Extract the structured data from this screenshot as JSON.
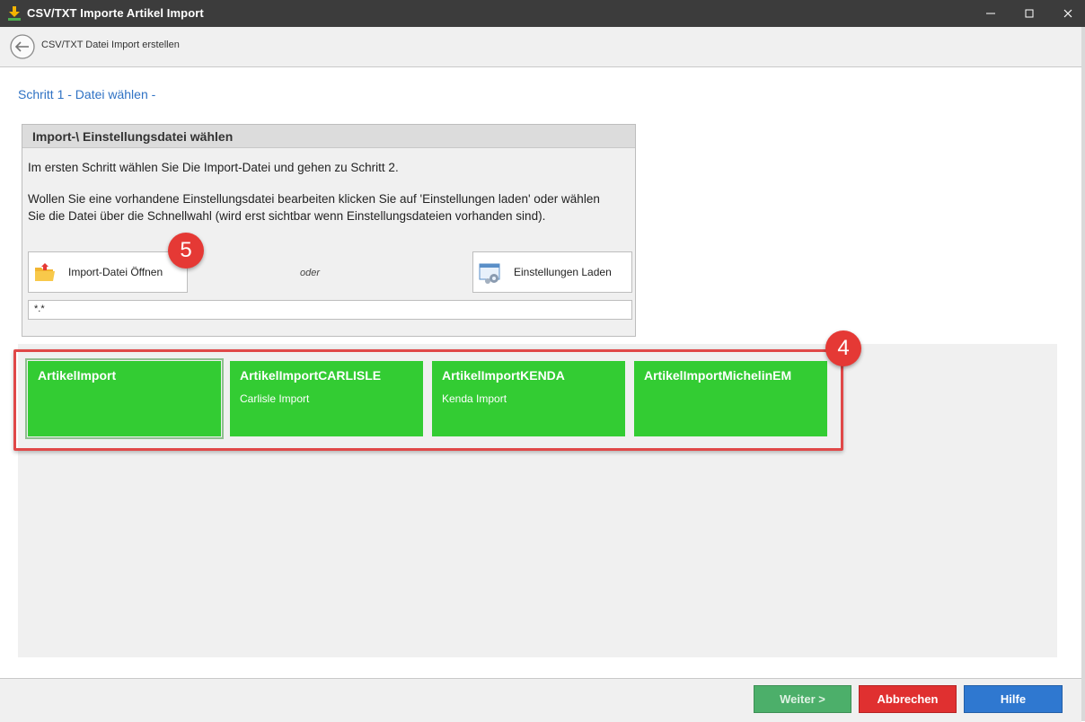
{
  "window": {
    "title": "CSV/TXT Importe Artikel Import"
  },
  "nav": {
    "title": "CSV/TXT Datei Import erstellen"
  },
  "step": {
    "title": "Schritt 1 - Datei wählen -"
  },
  "panel": {
    "title": "Import-\\ Einstellungsdatei wählen",
    "line1": "Im ersten Schritt wählen Sie Die Import-Datei und gehen zu Schritt 2.",
    "line2": "Wollen Sie eine vorhandene Einstellungsdatei bearbeiten klicken Sie auf 'Einstellungen laden' oder wählen",
    "line3": "Sie die Datei über die Schnellwahl (wird erst sichtbar wenn Einstellungsdateien vorhanden sind).",
    "open_button": "Import-Datei Öffnen",
    "or_text": "oder",
    "load_button": "Einstellungen Laden",
    "filter_value": "*.*"
  },
  "quick_select": {
    "tiles": [
      {
        "name": "ArtikelImport",
        "desc": ""
      },
      {
        "name": "ArtikelImportCARLISLE",
        "desc": "Carlisle Import"
      },
      {
        "name": "ArtikelImportKENDA",
        "desc": "Kenda Import"
      },
      {
        "name": "ArtikelImportMichelinEM",
        "desc": ""
      }
    ]
  },
  "callouts": {
    "badge_tiles": "4",
    "badge_open": "5"
  },
  "footer": {
    "next": "Weiter >",
    "cancel": "Abbrechen",
    "help": "Hilfe"
  },
  "colors": {
    "titlebar": "#3c3c3c",
    "accent_blue": "#2f72c4",
    "tile_green": "#33cc33",
    "callout_red": "#e53935",
    "next_button": "#4caf6a",
    "cancel_button": "#e03030",
    "help_button": "#2f78d0"
  }
}
